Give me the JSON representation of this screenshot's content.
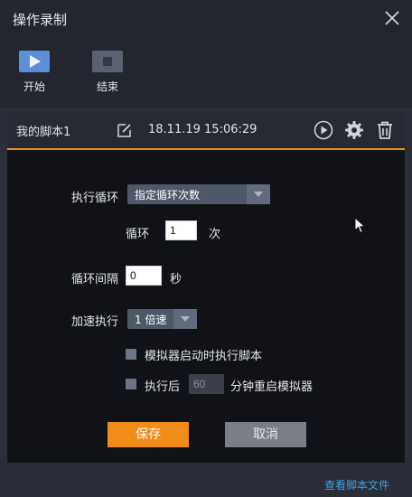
{
  "window": {
    "title": "操作录制"
  },
  "toolbar": {
    "start_label": "开始",
    "stop_label": "结束"
  },
  "script": {
    "name": "我的脚本1",
    "datetime": "18.11.19 15:06:29"
  },
  "form": {
    "loop_label": "执行循环",
    "loop_mode": "指定循环次数",
    "count_label": "循环",
    "count_value": "1",
    "count_unit": "次",
    "interval_label": "循环间隔",
    "interval_value": "0",
    "interval_unit": "秒",
    "speed_label": "加速执行",
    "speed_value": "1 倍速",
    "opt_autorun_label": "模拟器启动时执行脚本",
    "opt_restart_prefix": "执行后",
    "opt_restart_minutes": "60",
    "opt_restart_suffix": "分钟重启模拟器"
  },
  "buttons": {
    "save": "保存",
    "cancel": "取消"
  },
  "footer": {
    "view_scripts": "查看脚本文件"
  },
  "colors": {
    "accent": "#f08c1a",
    "link": "#3ea0e6",
    "start_button": "#5b8fd6",
    "stop_button": "#5a6171"
  }
}
